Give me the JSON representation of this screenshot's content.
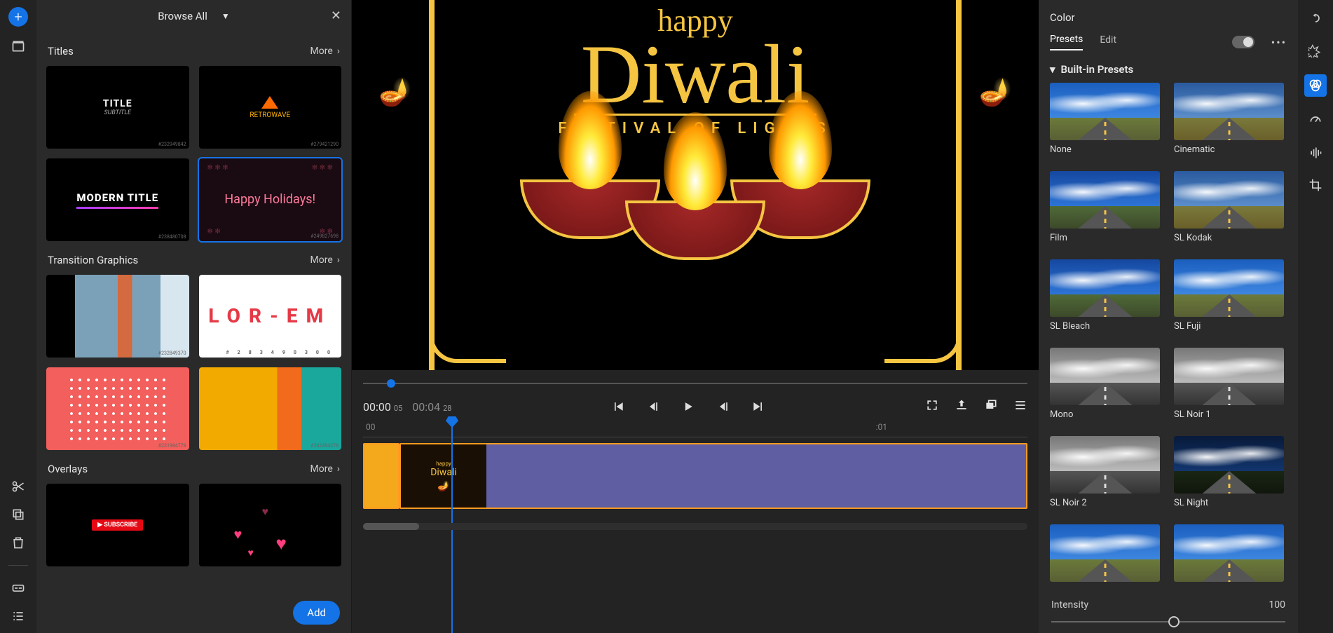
{
  "browse": {
    "header": "Browse All",
    "more": "More",
    "sections": {
      "titles": "Titles",
      "transitions": "Transition Graphics",
      "overlays": "Overlays"
    },
    "thumbs": {
      "title1_t": "TITLE",
      "title1_s": "SUBTITLE",
      "title2": "RETROWAVE",
      "title3": "MODERN TITLE",
      "title4": "Happy Holidays!",
      "trans2": "LOR-EM",
      "ov1": "▶ SUBSCRIBE"
    },
    "add_button": "Add"
  },
  "preview": {
    "happy": "happy",
    "diwali": "Diwali",
    "subtitle": "FESTIVAL OF LIGHTS"
  },
  "transport": {
    "current_tc": "00:00",
    "current_frames": "05",
    "total_tc": "00:04",
    "total_frames": "28"
  },
  "timeline": {
    "tick_start": "00",
    "tick_1s": ":01"
  },
  "color_panel": {
    "title": "Color",
    "tab_presets": "Presets",
    "tab_edit": "Edit",
    "section": "Built-in Presets",
    "presets": {
      "none": "None",
      "cinematic": "Cinematic",
      "film": "Film",
      "slkodak": "SL Kodak",
      "slbleach": "SL Bleach",
      "slfuji": "SL Fuji",
      "mono": "Mono",
      "slnoir1": "SL Noir 1",
      "slnoir2": "SL Noir 2",
      "slnight": "SL Night"
    },
    "intensity_label": "Intensity",
    "intensity_value": "100"
  }
}
